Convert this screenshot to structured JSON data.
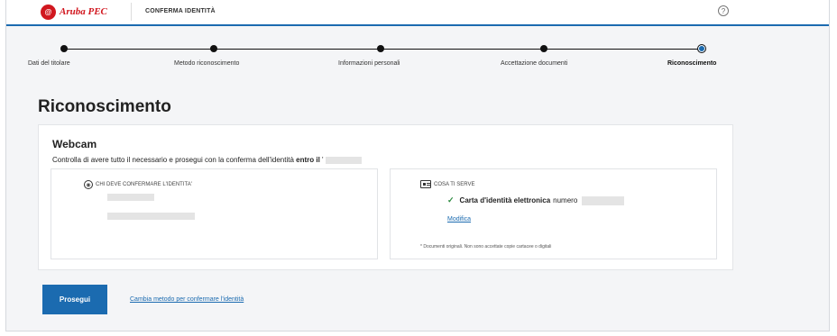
{
  "brand": {
    "mark": "@",
    "name": "Aruba PEC",
    "color": "#d1171f"
  },
  "header": {
    "page_label": "CONFERMA IDENTITÀ",
    "help_icon": "question-circle-icon",
    "help_symbol": "?"
  },
  "accent": "#1b6bb0",
  "stepper": {
    "steps": [
      {
        "label": "Dati del titolare",
        "state": "done"
      },
      {
        "label": "Metodo riconoscimento",
        "state": "done"
      },
      {
        "label": "Informazioni personali",
        "state": "done"
      },
      {
        "label": "Accettazione documenti",
        "state": "done"
      },
      {
        "label": "Riconoscimento",
        "state": "current"
      }
    ]
  },
  "main": {
    "title": "Riconoscimento",
    "card": {
      "title": "Webcam",
      "desc_prefix": "Controlla di avere tutto il necessario e prosegui con la conferma dell'identità ",
      "desc_bold": "entro il",
      "desc_suffix": " '",
      "who": {
        "icon": "user-circle-icon",
        "heading": "CHI DEVE CONFERMARE L'IDENTITA'"
      },
      "needs": {
        "icon": "id-card-icon",
        "heading": "COSA TI SERVE",
        "check_icon": "check-icon",
        "check_symbol": "✓",
        "doc_bold": "Carta d'identità elettronica",
        "doc_suffix": "numero",
        "edit_label": "Modifica",
        "note": "* Documenti originali. Non sono accettate copie cartacee o digitali"
      }
    }
  },
  "actions": {
    "primary_label": "Prosegui",
    "alt_label": "Cambia metodo per confermare l'identità"
  }
}
